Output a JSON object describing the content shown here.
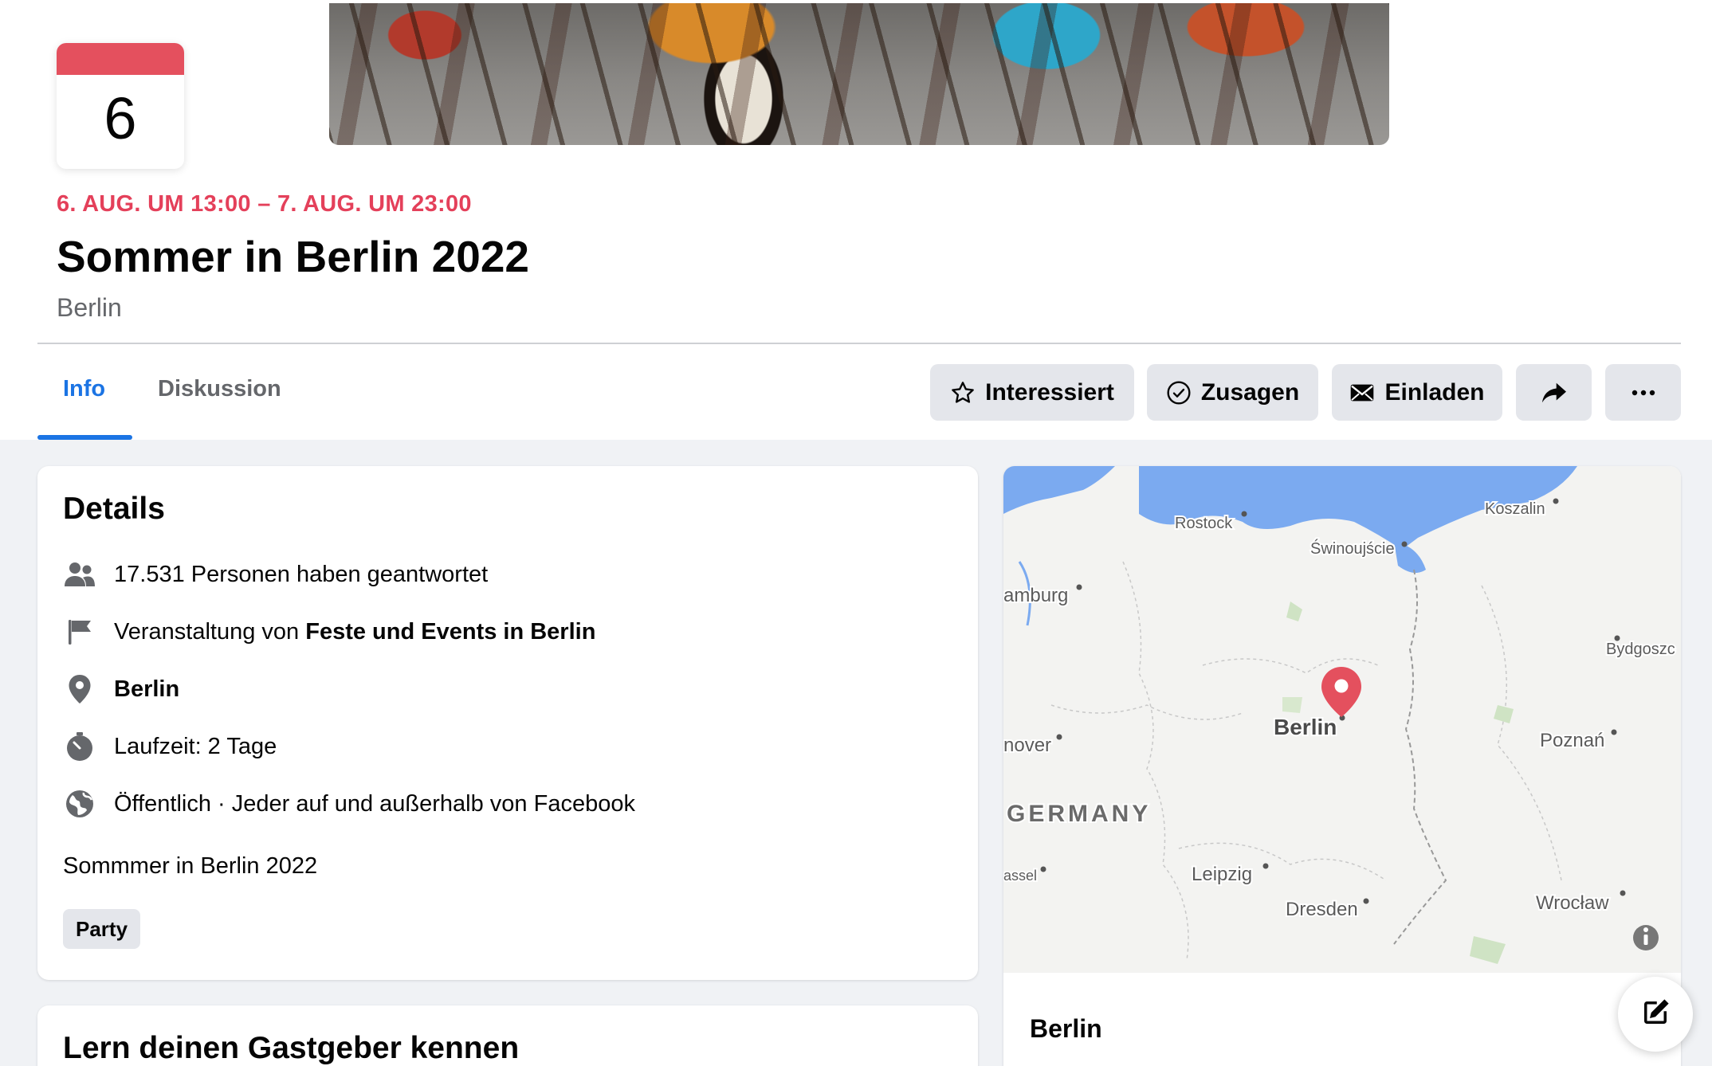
{
  "calendar": {
    "day": "6"
  },
  "event": {
    "date_range": "6. AUG. UM 13:00 – 7. AUG. UM 23:00",
    "title": "Sommer in Berlin 2022",
    "location": "Berlin"
  },
  "tabs": [
    {
      "label": "Info",
      "active": true
    },
    {
      "label": "Diskussion",
      "active": false
    }
  ],
  "actions": {
    "interested": "Interessiert",
    "going": "Zusagen",
    "invite": "Einladen"
  },
  "details": {
    "heading": "Details",
    "responses": "17.531 Personen haben geantwortet",
    "organizer_prefix": "Veranstaltung von ",
    "organizer": "Feste und Events in Berlin",
    "place": "Berlin",
    "duration": "Laufzeit: 2 Tage",
    "privacy": "Öffentlich · Jeder auf und außerhalb von Facebook",
    "description": "Sommmer in Berlin 2022",
    "tag": "Party"
  },
  "host": {
    "heading": "Lern deinen Gastgeber kennen"
  },
  "map": {
    "labels": {
      "rostock": "Rostock",
      "koszalin": "Koszalin",
      "swinoujscie": "Świnoujście",
      "hamburg": "amburg",
      "bydgoszcz": "Bydgoszc",
      "berlin": "Berlin",
      "hanover": "nover",
      "poznan": "Poznań",
      "germany": "GERMANY",
      "kassel": "assel",
      "leipzig": "Leipzig",
      "dresden": "Dresden",
      "wroclaw": "Wrocław"
    },
    "city": "Berlin"
  },
  "colors": {
    "accent": "#1b74e4",
    "date_red": "#e4405a",
    "water": "#7baaf0",
    "pin": "#e4505e"
  }
}
